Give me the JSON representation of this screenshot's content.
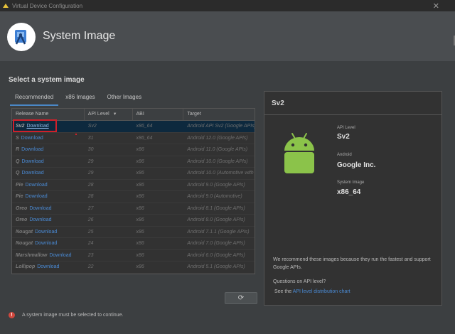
{
  "window": {
    "title": "Virtual Device Configuration",
    "close_glyph": "✕"
  },
  "header": {
    "title": "System Image"
  },
  "section_title": "Select a system image",
  "tabs": [
    {
      "label": "Recommended",
      "active": true
    },
    {
      "label": "x86 Images",
      "active": false
    },
    {
      "label": "Other Images",
      "active": false
    }
  ],
  "table": {
    "columns": [
      "Release Name",
      "API Level",
      "ABI",
      "Target"
    ],
    "sort_glyph": "▼",
    "download_label": "Download",
    "rows": [
      {
        "release": "Sv2",
        "api": "Sv2",
        "abi": "x86_64",
        "target": "Android API Sv2 (Google APIs)"
      },
      {
        "release": "S",
        "api": "31",
        "abi": "x86_64",
        "target": "Android 12.0 (Google APIs)"
      },
      {
        "release": "R",
        "api": "30",
        "abi": "x86",
        "target": "Android 11.0 (Google APIs)"
      },
      {
        "release": "Q",
        "api": "29",
        "abi": "x86",
        "target": "Android 10.0 (Google APIs)"
      },
      {
        "release": "Q",
        "api": "29",
        "abi": "x86",
        "target": "Android 10.0 (Automotive with Play Store)"
      },
      {
        "release": "Pie",
        "api": "28",
        "abi": "x86",
        "target": "Android 9.0 (Google APIs)"
      },
      {
        "release": "Pie",
        "api": "28",
        "abi": "x86",
        "target": "Android 9.0 (Automotive)"
      },
      {
        "release": "Oreo",
        "api": "27",
        "abi": "x86",
        "target": "Android 8.1 (Google APIs)"
      },
      {
        "release": "Oreo",
        "api": "26",
        "abi": "x86",
        "target": "Android 8.0 (Google APIs)"
      },
      {
        "release": "Nougat",
        "api": "25",
        "abi": "x86",
        "target": "Android 7.1.1 (Google APIs)"
      },
      {
        "release": "Nougat",
        "api": "24",
        "abi": "x86",
        "target": "Android 7.0 (Google APIs)"
      },
      {
        "release": "Marshmallow",
        "api": "23",
        "abi": "x86",
        "target": "Android 6.0 (Google APIs)"
      },
      {
        "release": "Lollipop",
        "api": "22",
        "abi": "x86",
        "target": "Android 5.1 (Google APIs)"
      }
    ]
  },
  "refresh_glyph": "⟳",
  "details": {
    "title": "Sv2",
    "api_level_label": "API Level",
    "api_level": "Sv2",
    "android_label": "Android",
    "vendor": "Google Inc.",
    "system_image_label": "System Image",
    "system_image": "x86_64",
    "recommendation": "We recommend these images because they run the fastest and support Google APIs.",
    "question": "Questions on API level?",
    "see_prefix": "See the ",
    "link_label": "API level distribution chart"
  },
  "error": {
    "icon": "!",
    "message": "A system image must be selected to continue."
  },
  "colors": {
    "accent": "#4a88c7",
    "link": "#4a8ad4",
    "error": "#d0483e",
    "android_green": "#8bc34a",
    "highlight_box": "#d0202a"
  }
}
